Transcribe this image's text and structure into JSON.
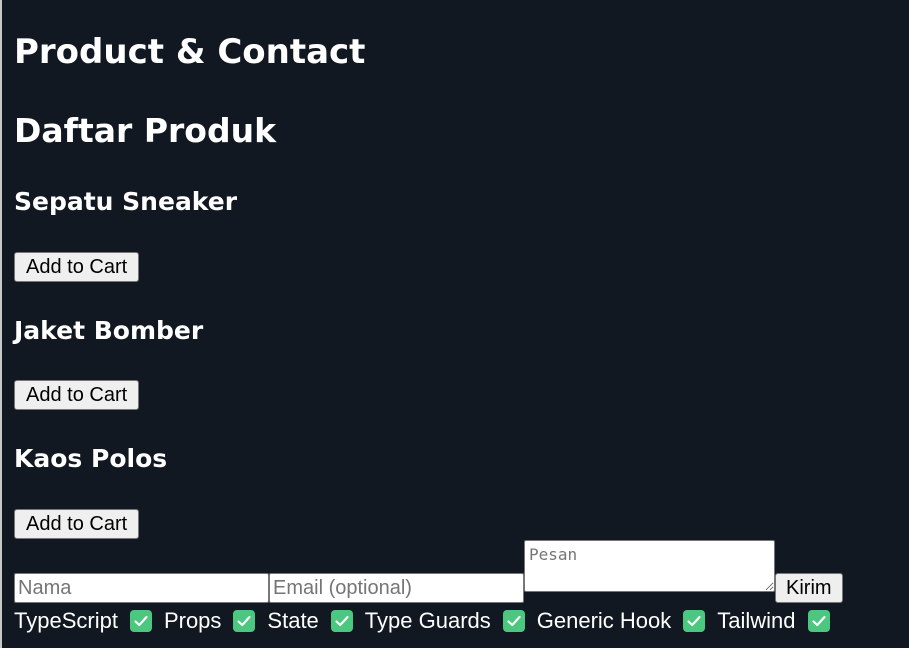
{
  "page": {
    "title": "Product & Contact"
  },
  "products_section": {
    "title": "Daftar Produk",
    "products": [
      {
        "name": "Sepatu Sneaker",
        "button_label": "Add to Cart"
      },
      {
        "name": "Jaket Bomber",
        "button_label": "Add to Cart"
      },
      {
        "name": "Kaos Polos",
        "button_label": "Add to Cart"
      }
    ]
  },
  "contact_form": {
    "name_placeholder": "Nama",
    "email_placeholder": "Email (optional)",
    "message_placeholder": "Pesan",
    "submit_label": "Kirim"
  },
  "tags": [
    {
      "label": "TypeScript",
      "icon": "check-mark-icon"
    },
    {
      "label": "Props",
      "icon": "check-mark-icon"
    },
    {
      "label": "State",
      "icon": "check-mark-icon"
    },
    {
      "label": "Type Guards",
      "icon": "check-mark-icon"
    },
    {
      "label": "Generic Hook",
      "icon": "check-mark-icon"
    },
    {
      "label": "Tailwind",
      "icon": "check-mark-icon"
    }
  ],
  "colors": {
    "background": "#111821",
    "text": "#ffffff",
    "check_green": "#4cc77f"
  }
}
